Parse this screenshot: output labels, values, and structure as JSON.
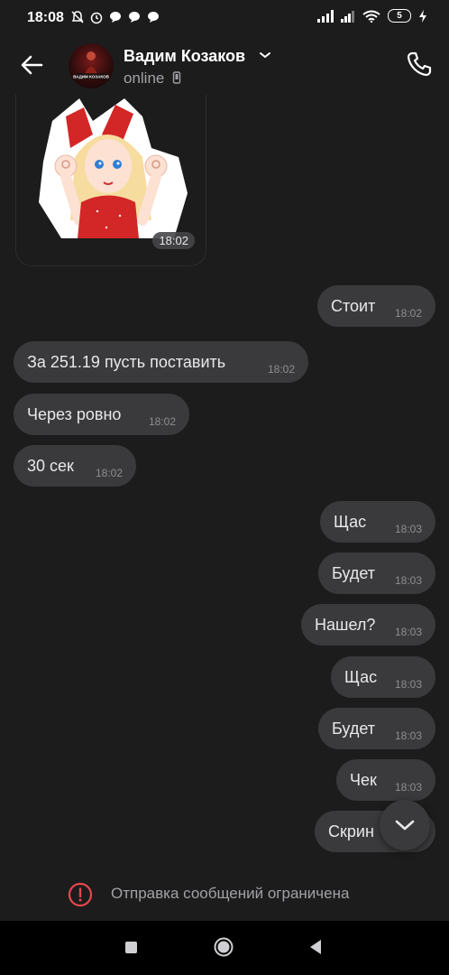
{
  "status_bar": {
    "time": "18:08",
    "battery": "5"
  },
  "header": {
    "contact_name": "Вадим Козаков",
    "contact_status": "online",
    "avatar_text": "ВАДИМ КОЗАКОВ"
  },
  "sticker": {
    "time": "18:02"
  },
  "messages": [
    {
      "direction": "out",
      "text": "Стоит",
      "time": "18:02"
    },
    {
      "direction": "in",
      "text": "За 251.19 пусть поставить",
      "time": "18:02"
    },
    {
      "direction": "in",
      "text": "Через ровно",
      "time": "18:02"
    },
    {
      "direction": "in",
      "text": "30 сек",
      "time": "18:02"
    },
    {
      "direction": "out",
      "text": "Щас",
      "time": "18:03"
    },
    {
      "direction": "out",
      "text": "Будет",
      "time": "18:03"
    },
    {
      "direction": "out",
      "text": "Нашел?",
      "time": "18:03"
    },
    {
      "direction": "out",
      "text": "Щас",
      "time": "18:03"
    },
    {
      "direction": "out",
      "text": "Будет",
      "time": "18:03"
    },
    {
      "direction": "out",
      "text": "Чек",
      "time": "18:03"
    },
    {
      "direction": "out",
      "text": "Скрин",
      "time": "18:03"
    }
  ],
  "notice": {
    "text": "Отправка сообщений ограничена"
  },
  "colors": {
    "background": "#1c1c1d",
    "bubble": "#3a3a3c",
    "notice_icon": "#e5484d"
  }
}
